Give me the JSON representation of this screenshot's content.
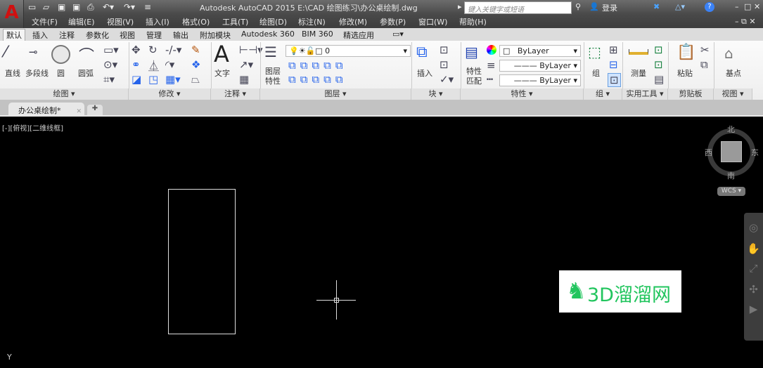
{
  "app": {
    "title": "Autodesk AutoCAD 2015    E:\\CAD 绘图练习\\办公桌绘制.dwg",
    "logo_letter": "A",
    "search_placeholder": "键入关键字或短语",
    "login": "登录",
    "help": "?"
  },
  "menu": [
    "文件(F)",
    "编辑(E)",
    "视图(V)",
    "插入(I)",
    "格式(O)",
    "工具(T)",
    "绘图(D)",
    "标注(N)",
    "修改(M)",
    "参数(P)",
    "窗口(W)",
    "帮助(H)"
  ],
  "ribbon_tabs": [
    "默认",
    "插入",
    "注释",
    "参数化",
    "视图",
    "管理",
    "输出",
    "附加模块",
    "Autodesk 360",
    "BIM 360",
    "精选应用"
  ],
  "panels": {
    "draw": {
      "label": "绘图",
      "tools": [
        "直线",
        "多段线",
        "圆",
        "圆弧"
      ]
    },
    "modify": {
      "label": "修改"
    },
    "annotation": {
      "label": "注释",
      "tools": [
        "文字"
      ]
    },
    "layers": {
      "label": "图层",
      "tools": [
        "图层\n特性"
      ],
      "layer_value": "0"
    },
    "block": {
      "label": "块",
      "tools": [
        "插入"
      ]
    },
    "properties": {
      "label": "特性",
      "tools": [
        "特性\n匹配"
      ],
      "color": "ByLayer",
      "linetype": "ByLayer",
      "lineweight": "ByLayer"
    },
    "groups": {
      "label": "组",
      "tools": [
        "组"
      ]
    },
    "utilities": {
      "label": "实用工具",
      "tools": [
        "测量"
      ]
    },
    "clipboard": {
      "label": "剪贴板",
      "tools": [
        "粘贴"
      ]
    },
    "view": {
      "label": "视图",
      "tools": [
        "基点"
      ]
    }
  },
  "document": {
    "tab": "办公桌绘制*",
    "viewport_label": "[-][俯视][二维线框]"
  },
  "viewcube": {
    "north": "北",
    "south": "南",
    "east": "东",
    "west": "西",
    "wcs": "WCS"
  },
  "ucs_label": "Y",
  "watermark": {
    "text": "3D溜溜网",
    "color": "#22c55e"
  },
  "colors": {
    "accent": "#d01010",
    "canvas": "#000000"
  }
}
